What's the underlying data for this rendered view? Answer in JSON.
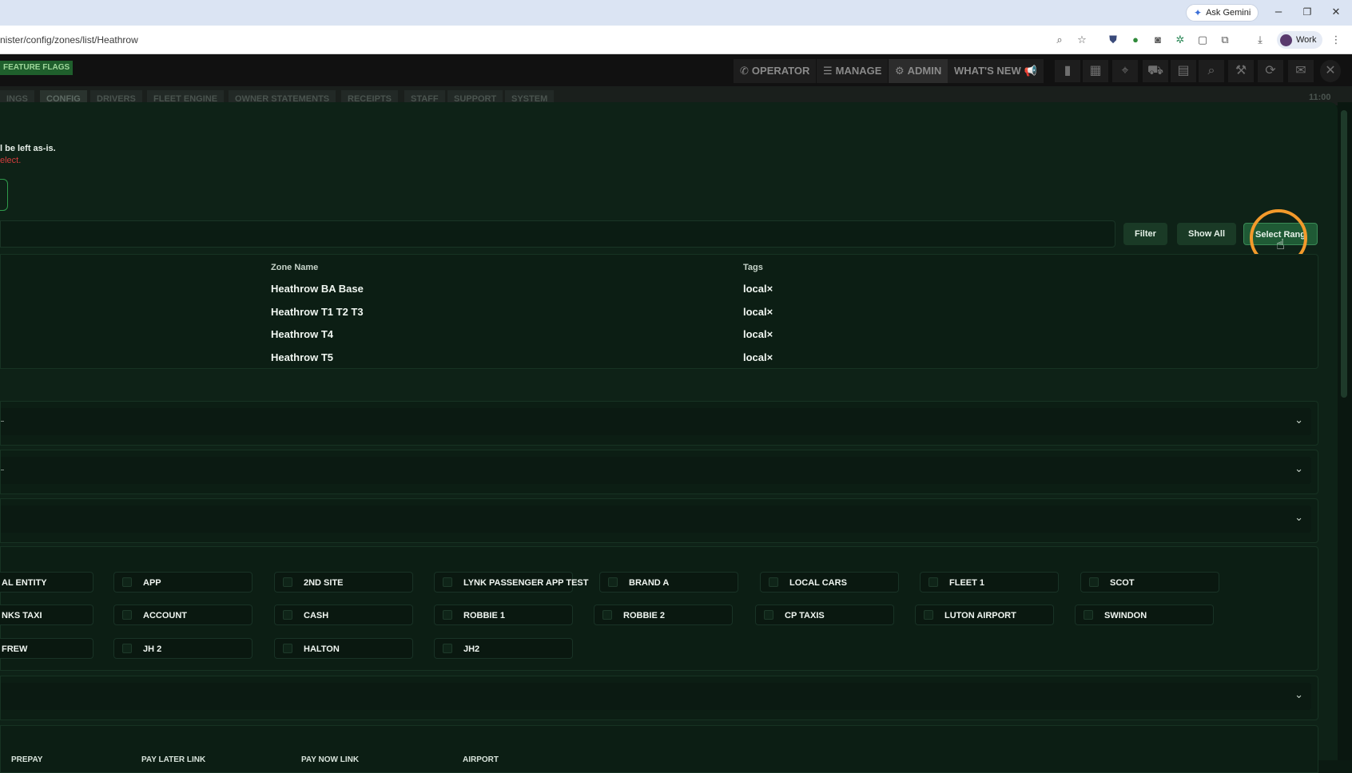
{
  "browser": {
    "ask_gemini": "Ask Gemini",
    "url": "nister/config/zones/list/Heathrow",
    "profile": "Work",
    "window_controls": [
      "–",
      "❐",
      "✕"
    ]
  },
  "nav": {
    "feature_flags": "FEATURE FLAGS",
    "operator": "OPERATOR",
    "manage": "MANAGE",
    "admin": "ADMIN",
    "whats_new": "WHAT'S NEW",
    "icons": [
      "chart-icon",
      "grid-icon",
      "map-pin-icon",
      "car-icon",
      "document-icon",
      "search-icon",
      "wrench-icon",
      "refresh-icon",
      "chat-icon",
      "close-icon"
    ]
  },
  "subtabs": [
    "INGS",
    "CONFIG",
    "DRIVERS",
    "FLEET ENGINE",
    "OWNER STATEMENTS",
    "RECEIPTS",
    "STAFF",
    "SUPPORT",
    "SYSTEM"
  ],
  "subtab_time": "11:00",
  "notes": {
    "line1": "l be left as-is.",
    "line2": "elect."
  },
  "actions": {
    "filter": "Filter",
    "show_all": "Show All",
    "select_range": "Select Rang"
  },
  "table": {
    "headers": {
      "zone_name": "Zone Name",
      "tags": "Tags"
    },
    "rows": [
      {
        "zone": "Heathrow BA Base",
        "tag": "local×"
      },
      {
        "zone": "Heathrow T1 T2 T3",
        "tag": "local×"
      },
      {
        "zone": "Heathrow T4",
        "tag": "local×"
      },
      {
        "zone": "Heathrow T5",
        "tag": "local×"
      }
    ]
  },
  "dropdown_chevron": "⌄",
  "chips_rows": [
    [
      "AL ENTITY",
      "APP",
      "2ND SITE",
      "LYNK PASSENGER APP TEST",
      "BRAND A",
      "LOCAL CARS",
      "FLEET 1",
      "SCOT"
    ],
    [
      "NKS TAXI",
      "ACCOUNT",
      "CASH",
      "ROBBIE 1",
      "ROBBIE 2",
      "CP TAXIS",
      "LUTON AIRPORT",
      "SWINDON"
    ],
    [
      "FREW",
      "JH 2",
      "HALTON",
      "JH2"
    ]
  ],
  "bottom_chips": [
    "PREPAY",
    "PAY LATER LINK",
    "PAY NOW LINK",
    "AIRPORT"
  ]
}
